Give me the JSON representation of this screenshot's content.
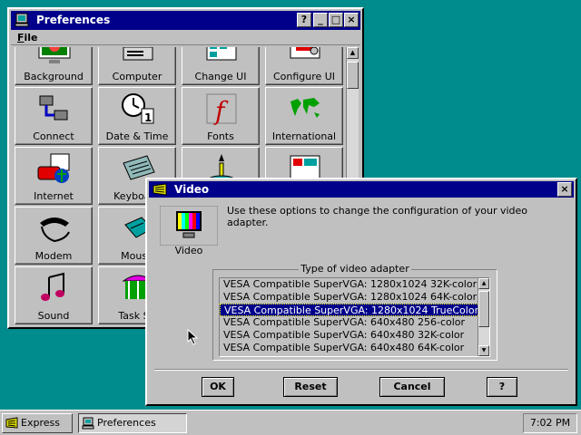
{
  "preferences_window": {
    "title": "Preferences",
    "menu": [
      "File"
    ],
    "title_buttons": [
      "?",
      "_",
      "□",
      "×"
    ],
    "items": [
      {
        "label": "Background",
        "icon": "background-icon"
      },
      {
        "label": "Computer",
        "icon": "computer-icon"
      },
      {
        "label": "Change UI",
        "icon": "change-ui-icon"
      },
      {
        "label": "Configure UI",
        "icon": "configure-ui-icon"
      },
      {
        "label": "Connect",
        "icon": "connect-icon"
      },
      {
        "label": "Date & Time",
        "icon": "clock-calendar-icon"
      },
      {
        "label": "Fonts",
        "icon": "fonts-icon"
      },
      {
        "label": "International",
        "icon": "world-map-icon"
      },
      {
        "label": "Internet",
        "icon": "internet-phone-icon"
      },
      {
        "label": "Keyboard",
        "icon": "keyboard-icon"
      },
      {
        "label": "",
        "icon": "lamp-icon"
      },
      {
        "label": "",
        "icon": "multimedia-icon"
      },
      {
        "label": "Modem",
        "icon": "modem-phone-icon"
      },
      {
        "label": "Mouse",
        "icon": "mouse-icon"
      },
      {
        "label": "",
        "icon": "blank-icon"
      },
      {
        "label": "",
        "icon": "blank-icon"
      },
      {
        "label": "Sound",
        "icon": "music-note-icon"
      },
      {
        "label": "Task Su",
        "icon": "carousel-icon"
      },
      {
        "label": "",
        "icon": "blank-icon"
      },
      {
        "label": "",
        "icon": "blank-icon"
      }
    ]
  },
  "video_dialog": {
    "title": "Video",
    "close_button": "×",
    "icon_label": "Video",
    "description": "Use these options to change the configuration of your video adapter.",
    "group_label": "Type of video adapter",
    "adapters": [
      {
        "label": "VESA Compatible SuperVGA: 1280x1024 32K-color",
        "selected": false
      },
      {
        "label": "VESA Compatible SuperVGA: 1280x1024 64K-color",
        "selected": false
      },
      {
        "label": "VESA Compatible SuperVGA: 1280x1024 TrueColor",
        "selected": true
      },
      {
        "label": "VESA Compatible SuperVGA: 640x480 256-color",
        "selected": false
      },
      {
        "label": "VESA Compatible SuperVGA: 640x480 32K-color",
        "selected": false
      },
      {
        "label": "VESA Compatible SuperVGA: 640x480 64K-color",
        "selected": false
      }
    ],
    "buttons": {
      "ok": "OK",
      "reset": "Reset",
      "cancel": "Cancel",
      "help": "?"
    }
  },
  "taskbar": {
    "start_label": "Express",
    "task_label": "Preferences",
    "clock": "7:02 PM"
  },
  "colors": {
    "desktop": "#008c8c",
    "titlebar": "#00008a",
    "face": "#c0c0c0",
    "selection": "#00008a"
  }
}
